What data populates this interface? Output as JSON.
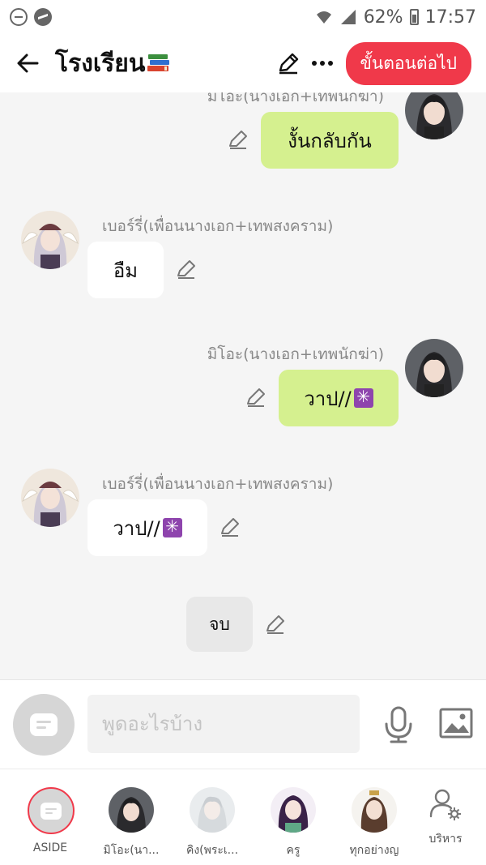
{
  "status_bar": {
    "battery": "62%",
    "time": "17:57"
  },
  "header": {
    "title": "โรงเรียน",
    "next_button": "ขั้นตอนต่อไป"
  },
  "messages": [
    {
      "sender": "มิโอะ(นางเอก+เทพนักฆ่า)",
      "side": "mine",
      "text": "งั้นกลับกัน"
    },
    {
      "sender": "เบอร์รี่(เพื่อนนางเอก+เทพสงคราม)",
      "side": "theirs",
      "text": "อืม"
    },
    {
      "sender": "มิโอะ(นางเอก+เทพนักฆ่า)",
      "side": "mine",
      "text": "วาป//"
    },
    {
      "sender": "เบอร์รี่(เพื่อนนางเอก+เทพสงคราม)",
      "side": "theirs",
      "text": "วาป//"
    },
    {
      "sender": "",
      "side": "neutral",
      "text": "จบ"
    }
  ],
  "input": {
    "placeholder": "พูดอะไรบ้าง"
  },
  "bottom_nav": {
    "items": [
      {
        "label": "ASIDE"
      },
      {
        "label": "มิโอะ(นา..."
      },
      {
        "label": "คิง(พระเ..."
      },
      {
        "label": "ครู"
      },
      {
        "label": "ทุกอย่างญ"
      },
      {
        "label": "บริหาร"
      }
    ]
  },
  "colors": {
    "accent": "#f0394a",
    "my_bubble": "#d5f08f",
    "their_bubble": "#ffffff",
    "chat_background": "#f5f5f5"
  },
  "icons": [
    "back-arrow-icon",
    "pencil-icon",
    "more-dots-icon",
    "microphone-icon",
    "image-icon",
    "admin-user-gear-icon",
    "chat-bubble-icon"
  ]
}
